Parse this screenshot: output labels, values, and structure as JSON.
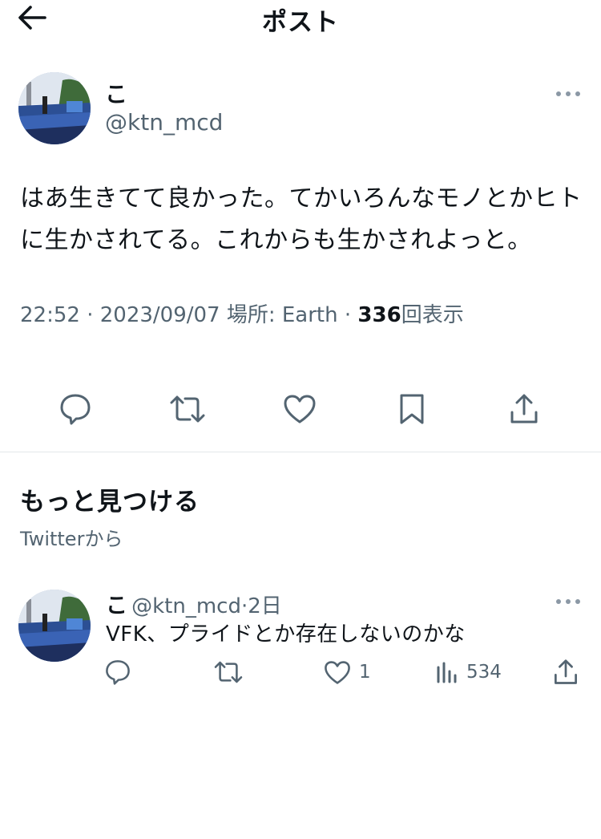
{
  "header": {
    "title": "ポスト"
  },
  "post": {
    "author_name": "こ",
    "author_handle": "@ktn_mcd",
    "text": "はあ生きてて良かった。てかいろんなモノとかヒトに生かされてる。これからも生かされよっと。",
    "time": "22:52",
    "date": "2023/09/07",
    "location_label": "場所: Earth",
    "views": "336",
    "views_label": "回表示",
    "separator": "·"
  },
  "discover": {
    "title": "もっと見つける",
    "subtitle": "Twitterから"
  },
  "related": {
    "author_name": "こ",
    "author_handle": "@ktn_mcd",
    "separator": "·",
    "age": "2日",
    "text": "VFK、プライドとか存在しないのかな",
    "likes": "1",
    "views": "534"
  },
  "icons": [
    "back-arrow-icon",
    "more-icon",
    "reply-icon",
    "retweet-icon",
    "like-icon",
    "bookmark-icon",
    "share-icon",
    "views-icon"
  ],
  "colors": {
    "text": "#0f1419",
    "secondary": "#536471",
    "divider": "#e3e7ea"
  }
}
